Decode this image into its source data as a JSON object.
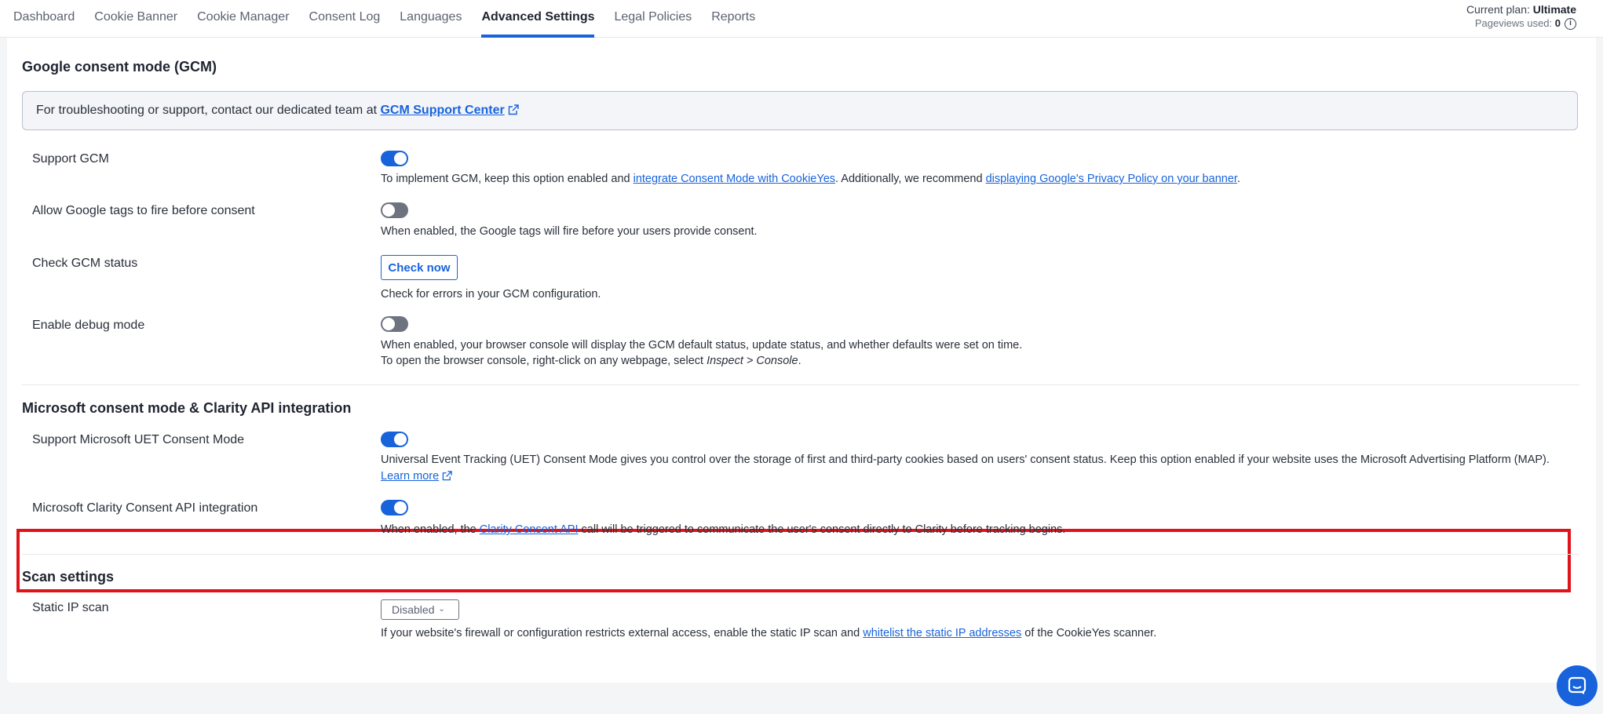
{
  "nav": {
    "tabs": [
      "Dashboard",
      "Cookie Banner",
      "Cookie Manager",
      "Consent Log",
      "Languages",
      "Advanced Settings",
      "Legal Policies",
      "Reports"
    ],
    "active_tab": "Advanced Settings"
  },
  "plan": {
    "label": "Current plan:",
    "value": "Ultimate",
    "pageviews_label": "Pageviews used:",
    "pageviews_value": "0"
  },
  "gcm": {
    "title": "Google consent mode (GCM)",
    "notice_text": "For troubleshooting or support, contact our dedicated team at",
    "notice_link": "GCM Support Center",
    "support": {
      "label": "Support GCM",
      "enabled": true,
      "desc_1": "To implement GCM, keep this option enabled and",
      "link_1": "integrate Consent Mode with CookieYes",
      "desc_2": ". Additionally, we recommend",
      "link_2": "displaying Google's Privacy Policy on your banner",
      "desc_3": "."
    },
    "allow_tags": {
      "label": "Allow Google tags to fire before consent",
      "enabled": false,
      "desc": "When enabled, the Google tags will fire before your users provide consent."
    },
    "check_status": {
      "label": "Check GCM status",
      "button": "Check now",
      "desc": "Check for errors in your GCM configuration."
    },
    "debug": {
      "label": "Enable debug mode",
      "enabled": false,
      "desc_1": "When enabled, your browser console will display the GCM default status, update status, and whether defaults were set on time.",
      "desc_2a": "To open the browser console, right-click on any webpage, select",
      "desc_2b": "Inspect > Console",
      "desc_2c": "."
    }
  },
  "microsoft": {
    "title": "Microsoft consent mode & Clarity API integration",
    "uet": {
      "label": "Support Microsoft UET Consent Mode",
      "enabled": true,
      "desc": "Universal Event Tracking (UET) Consent Mode gives you control over the storage of first and third-party cookies based on users' consent status. Keep this option enabled if your website uses the Microsoft Advertising Platform (MAP).",
      "learn_more": "Learn more"
    },
    "clarity": {
      "label": "Microsoft Clarity Consent API integration",
      "enabled": true,
      "desc_1": "When enabled, the",
      "link": "Clarity Consent API",
      "desc_2": "call will be triggered to communicate the user's consent directly to Clarity before tracking begins."
    }
  },
  "scan": {
    "title": "Scan settings",
    "static_ip": {
      "label": "Static IP scan",
      "selected": "Disabled",
      "desc_1": "If your website's firewall or configuration restricts external access, enable the static IP scan and",
      "link": "whitelist the static IP addresses",
      "desc_2": "of the CookieYes scanner."
    }
  },
  "icons": {
    "external_link": "external-link-icon",
    "info": "info-icon",
    "chevron": "chevron-down-icon",
    "chat": "chat-icon"
  },
  "colors": {
    "accent": "#1863dc",
    "highlight": "#e0121a",
    "toggle_off": "#6e7380"
  }
}
